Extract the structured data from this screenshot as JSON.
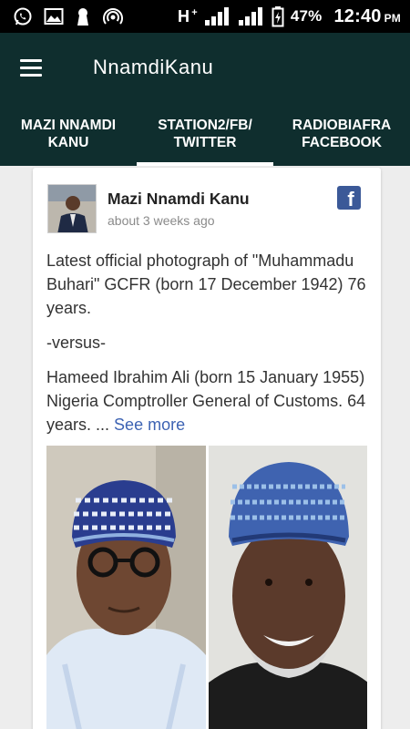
{
  "status_bar": {
    "network": "H",
    "network_sup": "+",
    "battery_percent": "47%",
    "time": "12:40",
    "ampm": "PM"
  },
  "app_bar": {
    "title": "NnamdiKanu"
  },
  "tabs": [
    {
      "label": "MAZI NNAMDI\nKANU",
      "active": false
    },
    {
      "label": "STATION2/FB/\nTWITTER",
      "active": true
    },
    {
      "label": "RADIOBIAFRA\nFACEBOOK",
      "active": false
    }
  ],
  "post": {
    "author": "Mazi Nnamdi Kanu",
    "time": "about 3 weeks ago",
    "paragraph1": "Latest official photograph of \"Muhammadu Buhari\" GCFR (born 17 December 1942) 76 years.",
    "paragraph2": "-versus-",
    "paragraph3": "Hameed Ibrahim Ali (born 15 January 1955) Nigeria Comptroller General of Customs. 64 years. ...",
    "see_more": "See more",
    "source_icon": "facebook-icon"
  },
  "colors": {
    "app_bar": "#0f2e2e",
    "link": "#3d63b3",
    "facebook": "#3b5998"
  }
}
